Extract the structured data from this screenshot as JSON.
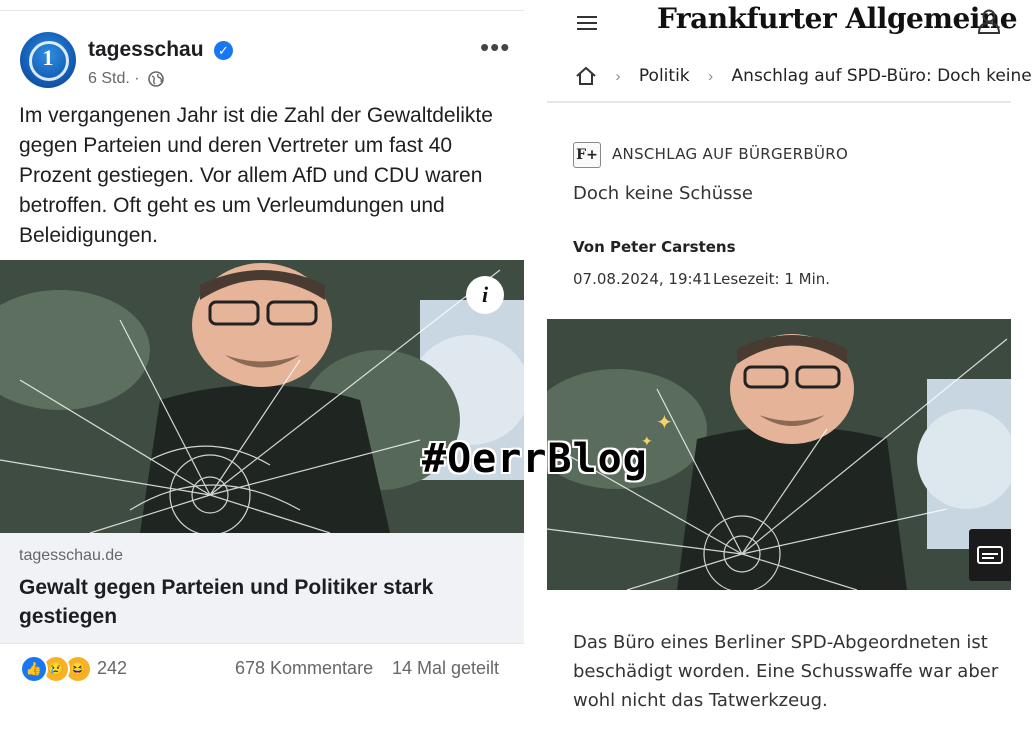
{
  "facebook_post": {
    "page_name": "tagesschau",
    "time": "6 Std. ·",
    "post_text": "Im vergangenen Jahr ist die Zahl der Gewaltdelikte gegen Parteien und deren Vertreter um fast 40 Prozent gestiegen. Vor allem AfD und CDU waren betroffen. Oft geht es um Verleumdungen und Beleidigungen.",
    "link_domain": "tagesschau.de",
    "link_headline": "Gewalt gegen Parteien und Politiker stark gestiegen",
    "reactions_count": "242",
    "comments": "678 Kommentare",
    "shares": "14 Mal geteilt",
    "icons": [
      "verified-badge-icon",
      "globe-icon",
      "more-icon",
      "info-icon",
      "like-reaction-icon",
      "sad-reaction-icon",
      "haha-reaction-icon"
    ],
    "colors": {
      "brand": "#1877f2",
      "secondary_text": "#65676b",
      "link_bg": "#f0f2f5"
    }
  },
  "faz_article": {
    "logo": "Frankfurter Allgemeine",
    "breadcrumb": [
      "Politik",
      "Anschlag auf SPD-Büro: Doch keine"
    ],
    "premium_badge": "F+",
    "kicker": "ANSCHLAG AUF BÜRGERBÜRO",
    "title": "Doch keine Schüsse",
    "author": "Von Peter Carstens",
    "date": "07.08.2024, 19:41",
    "reading_time": "Lesezeit: 1 Min.",
    "body": "Das Büro eines Berliner SPD-Abgeordneten ist beschädigt worden. Eine Schusswaffe war aber wohl nicht das Tatwerkzeug.",
    "icons": [
      "menu-icon",
      "user-icon",
      "home-icon",
      "chevron-right-icon",
      "caption-icon"
    ]
  },
  "overlay": {
    "tag": "#OerrBlog"
  }
}
